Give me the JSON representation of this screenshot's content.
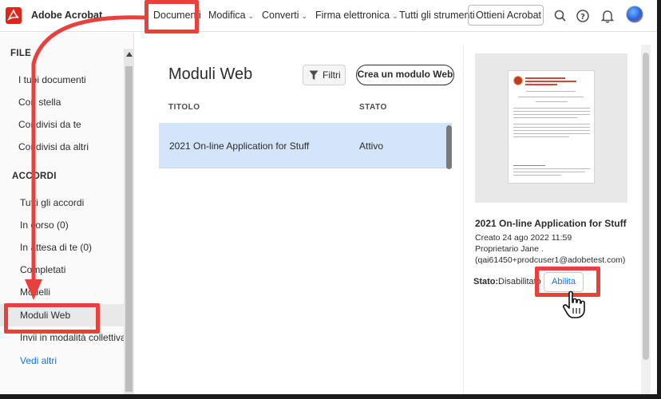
{
  "topbar": {
    "app_name": "Adobe Acrobat",
    "nav": [
      "Documenti",
      "Modifica",
      "Converti",
      "Firma elettronica",
      "Tutti gli strumenti"
    ],
    "get_button": "Ottieni Acrobat"
  },
  "sidebar": {
    "section_file": "FILE",
    "file_items": [
      "I tuoi documenti",
      "Con stella",
      "Condivisi da te",
      "Condivisi da altri"
    ],
    "section_agreements": "ACCORDI",
    "agreement_items": [
      "Tutti gli accordi",
      "In corso (0)",
      "In attesa di te (0)",
      "Completati",
      "Modelli",
      "Moduli Web",
      "Invii in modalità collettiva"
    ],
    "see_more": "Vedi altri"
  },
  "main": {
    "title": "Moduli Web",
    "filter_button": "Filtri",
    "create_button": "Crea un modulo Web",
    "columns": {
      "title": "TITOLO",
      "status": "STATO"
    },
    "rows": [
      {
        "title": "2021 On-line Application for Stuff",
        "status": "Attivo"
      }
    ]
  },
  "details": {
    "title": "2021 On-line Application for Stuff",
    "created": "Creato 24 ago 2022 11:59",
    "owner": "Proprietario Jane .",
    "email": "(qai61450+prodcuser1@adobetest.com)",
    "status_label": "Stato:",
    "status_value": "Disabilitato",
    "enable_button": "Abilita"
  },
  "colors": {
    "accent_blue": "#1473e6",
    "annotation_red": "#e8413d",
    "selected_row": "#d3e4fb",
    "brand_red": "#e1251b"
  }
}
